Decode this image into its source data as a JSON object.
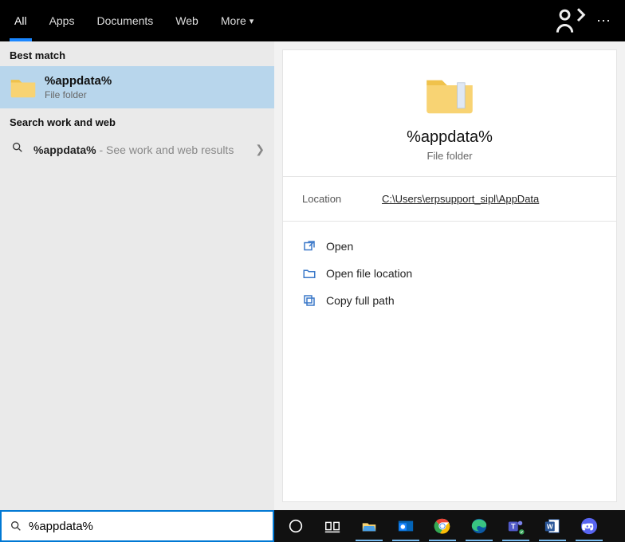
{
  "tabs": {
    "all": "All",
    "apps": "Apps",
    "documents": "Documents",
    "web": "Web",
    "more": "More"
  },
  "groups": {
    "best_match": "Best match",
    "search_work_web": "Search work and web"
  },
  "best_match_item": {
    "title": "%appdata%",
    "subtitle": "File folder"
  },
  "web_result": {
    "term": "%appdata%",
    "hint": " - See work and web results"
  },
  "preview": {
    "title": "%appdata%",
    "subtitle": "File folder",
    "location_label": "Location",
    "location_value": "C:\\Users\\erpsupport_sipl\\AppData"
  },
  "actions": {
    "open": "Open",
    "open_loc": "Open file location",
    "copy_path": "Copy full path"
  },
  "search_value": "%appdata%",
  "more_menu_dots": "⋯"
}
